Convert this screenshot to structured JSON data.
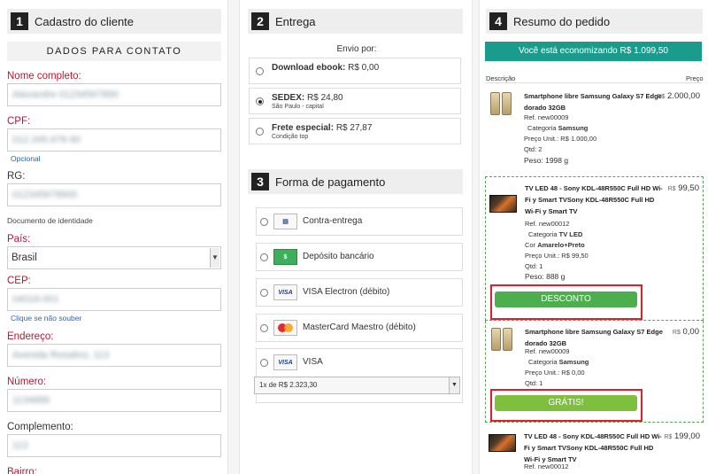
{
  "customer": {
    "number": "1",
    "title": "Cadastro do cliente",
    "contact_header": "DADOS PARA CONTATO",
    "fields": {
      "nome": {
        "label": "Nome completo:",
        "value": "Alexandre 01234567890"
      },
      "cpf": {
        "label": "CPF:",
        "value": "012.345.678-90",
        "hint": "Opcional"
      },
      "rg": {
        "label": "RG:",
        "value": "012345678900",
        "hint": "Documento de identidade"
      },
      "pais": {
        "label": "País:",
        "value": "Brasil"
      },
      "cep": {
        "label": "CEP:",
        "value": "04016-001",
        "hint": "Clique se não souber"
      },
      "endereco": {
        "label": "Endereço:",
        "value": "Avenida Rosalinú, 113"
      },
      "numero": {
        "label": "Número:",
        "value": "1134888"
      },
      "complemento": {
        "label": "Complemento:",
        "value": "113"
      },
      "bairro": {
        "label": "Bairro:"
      }
    }
  },
  "delivery": {
    "number": "2",
    "title": "Entrega",
    "envio_label": "Envio por:",
    "options": [
      {
        "name": "Download ebook:",
        "price": "R$ 0,00",
        "sub": "",
        "selected": false
      },
      {
        "name": "SEDEX:",
        "price": "R$ 24,80",
        "sub": "São Paulo - capital",
        "selected": true
      },
      {
        "name": "Frete especial:",
        "price": "R$ 27,87",
        "sub": "Condição top",
        "selected": false
      }
    ]
  },
  "payment": {
    "number": "3",
    "title": "Forma de pagamento",
    "options": [
      {
        "label": "Contra-entrega",
        "icon": "cash-on-delivery-icon"
      },
      {
        "label": "Depósito bancário",
        "icon": "bank-deposit-icon"
      },
      {
        "label": "VISA Electron (débito)",
        "icon": "visa-electron-icon"
      },
      {
        "label": "MasterCard Maestro (débito)",
        "icon": "mastercard-maestro-icon"
      },
      {
        "label": "VISA",
        "icon": "visa-icon"
      }
    ],
    "installments": "1x de R$ 2.323,30"
  },
  "summary": {
    "number": "4",
    "title": "Resumo do pedido",
    "savings": "Você está economizando R$ 1.099,50",
    "col_desc": "Descrição",
    "col_price": "Preço",
    "items": [
      {
        "name": "Smartphone libre Samsung Galaxy S7 Edge dorado 32GB",
        "ref": "Ref. new00009",
        "category_label": "Categoria",
        "category": "Samsung",
        "unit_label": "Preço Unit.:",
        "unit": "R$ 1.000,00",
        "qty": "Qtd: 2",
        "weight": "Peso: 1998 g",
        "currency": "R$",
        "price": "2.000,00"
      },
      {
        "name": "TV LED 48 - Sony KDL-48R550C Full HD Wi-Fi y Smart TVSony KDL-48R550C Full HD Wi-Fi y Smart TV",
        "ref": "Ref. new00012",
        "category_label": "Categoria",
        "category": "TV LED",
        "color_label": "Cor",
        "color": "Amarelo+Preto",
        "unit_label": "Preço Unit.:",
        "unit": "R$ 99,50",
        "qty": "Qtd: 1",
        "weight": "Peso: 888 g",
        "currency": "R$",
        "price": "99,50",
        "button": "DESCONTO"
      },
      {
        "name": "Smartphone libre Samsung Galaxy S7 Edge dorado 32GB",
        "ref": "Ref. new00009",
        "category_label": "Categoria",
        "category": "Samsung",
        "unit_label": "Preço Unit.:",
        "unit": "R$ 0,00",
        "qty": "Qtd: 1",
        "currency": "R$",
        "price": "0,00",
        "button": "GRÁTIS!"
      },
      {
        "name": "TV LED 48 - Sony KDL-48R550C Full HD Wi-Fi y Smart TVSony KDL-48R550C Full HD Wi-Fi y Smart TV",
        "ref": "Ref. new00012",
        "currency": "R$",
        "price": "199,00"
      }
    ]
  },
  "colors": {
    "required": "#c8102e",
    "savings_bar": "#1a9c8c",
    "button_green": "#4cae4c",
    "highlight_red": "#e01f2a"
  }
}
